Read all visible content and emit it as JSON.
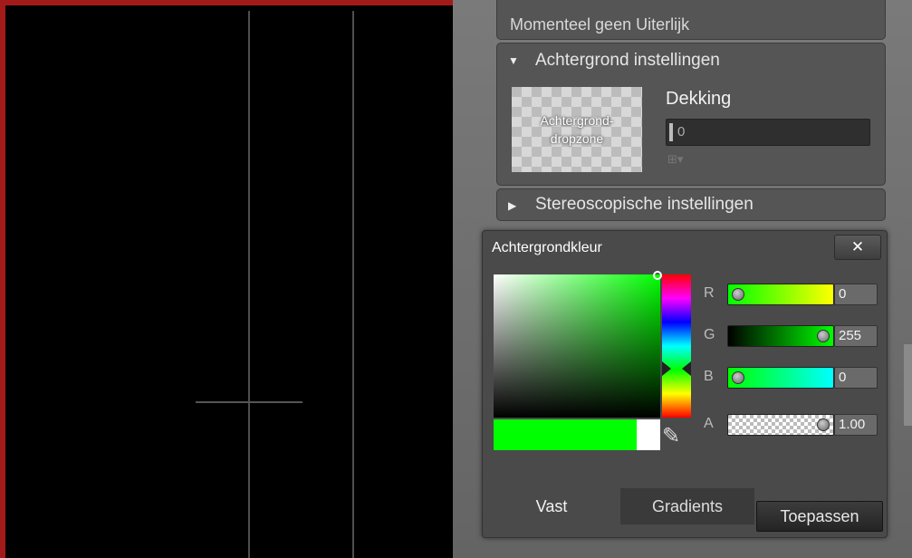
{
  "appearance_panel": {
    "title": "Momenteel geen Uiterlijk"
  },
  "background_settings": {
    "title": "Achtergrond instellingen",
    "dropzone_label": "Achtergrond-dropzone",
    "opacity_label": "Dekking",
    "opacity_value": "0"
  },
  "stereo_settings": {
    "title": "Stereoscopische instellingen"
  },
  "color_dialog": {
    "title": "Achtergrondkleur",
    "close_label": "✕",
    "channels": [
      {
        "label": "R",
        "value": "0"
      },
      {
        "label": "G",
        "value": "255"
      },
      {
        "label": "B",
        "value": "0"
      },
      {
        "label": "A",
        "value": "1.00"
      }
    ],
    "current_color": "#00ff00",
    "previous_color": "#ffffff",
    "tabs": [
      {
        "label": "Vast"
      },
      {
        "label": "Gradients"
      }
    ],
    "apply_label": "Toepassen"
  },
  "icons": [
    "expand-triangle-icon",
    "collapse-triangle-icon",
    "close-icon",
    "eyedropper-icon",
    "layout-dropdown-icon"
  ]
}
